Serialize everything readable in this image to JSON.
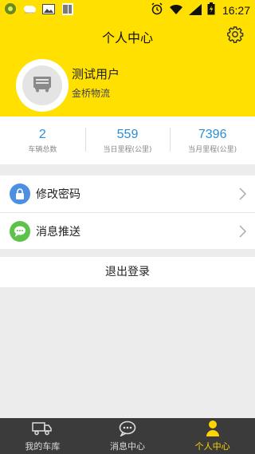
{
  "status_bar": {
    "time": "16:27",
    "icons": [
      "app-notification-icon",
      "weather-icon",
      "image-notification-icon",
      "barcode-icon",
      "alarm-icon",
      "wifi-icon",
      "signal-icon",
      "battery-charging-icon"
    ]
  },
  "header": {
    "title": "个人中心",
    "settings_icon": "gear-icon",
    "avatar_icon": "truck-icon",
    "username": "测试用户",
    "company": "金桥物流"
  },
  "stats": [
    {
      "value": "2",
      "label": "车辆总数"
    },
    {
      "value": "559",
      "label": "当日里程(公里)"
    },
    {
      "value": "7396",
      "label": "当月里程(公里)"
    }
  ],
  "menu": [
    {
      "label": "修改密码",
      "icon": "lock-icon",
      "icon_color": "#4d8fe0"
    },
    {
      "label": "消息推送",
      "icon": "chat-icon",
      "icon_color": "#5cc24a"
    }
  ],
  "logout_label": "退出登录",
  "bottom_nav": [
    {
      "label": "我的车库",
      "icon": "truck-icon",
      "active": false
    },
    {
      "label": "消息中心",
      "icon": "chat-bubble-icon",
      "active": false
    },
    {
      "label": "个人中心",
      "icon": "person-icon",
      "active": true
    }
  ],
  "colors": {
    "accent_yellow": "#ffe000",
    "stat_blue": "#2a8fd6",
    "nav_bg": "#3b3b3b",
    "nav_active": "#ffd400"
  }
}
